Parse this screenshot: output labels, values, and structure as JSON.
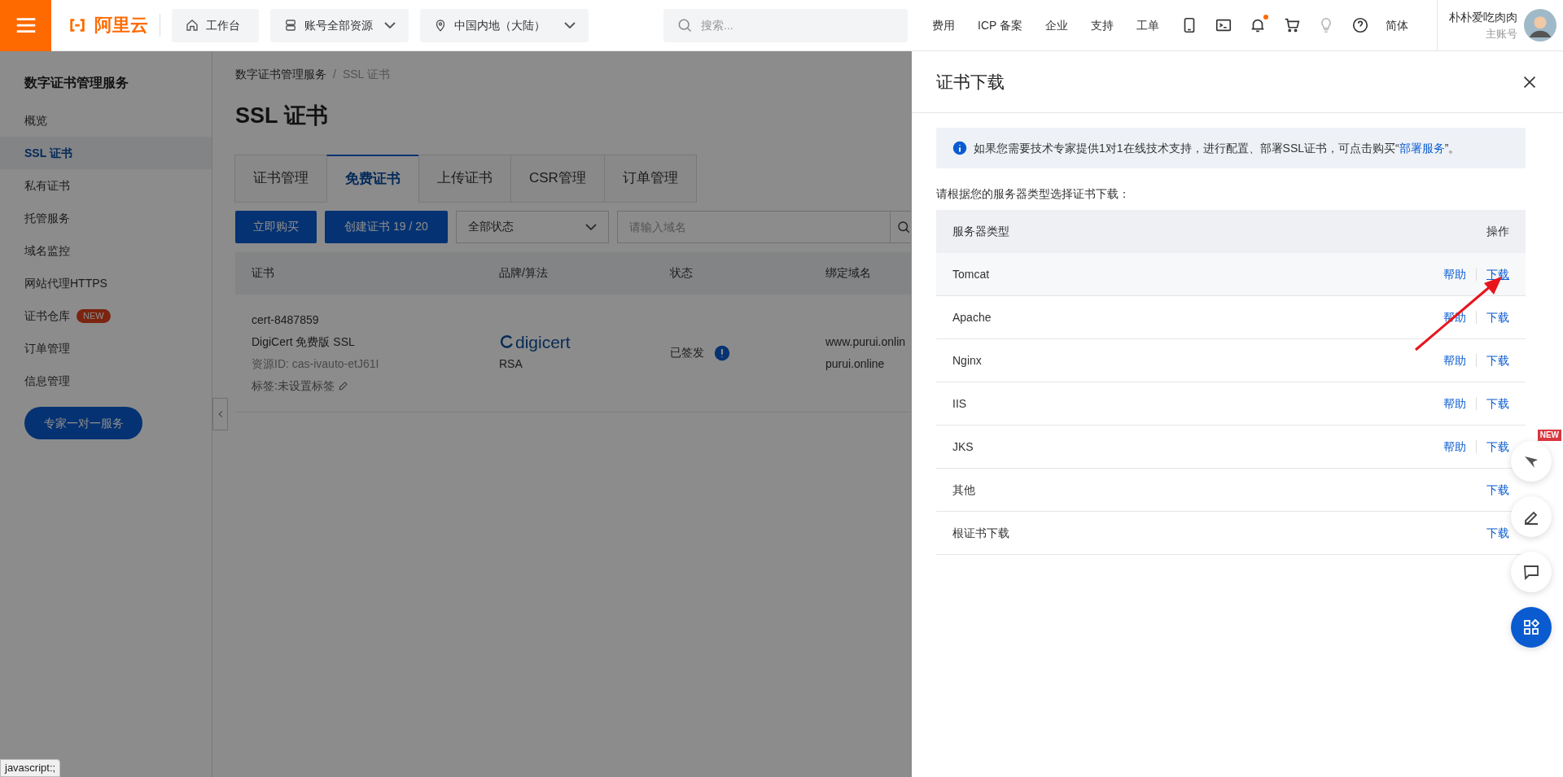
{
  "topbar": {
    "logo_text": "阿里云",
    "workbench": "工作台",
    "resource_select": "账号全部资源",
    "region_select": "中国内地（大陆）",
    "search_placeholder": "搜索...",
    "nav_links": [
      "费用",
      "ICP 备案",
      "企业",
      "支持",
      "工单"
    ],
    "notifications_unread": true,
    "language": "简体",
    "user_name": "朴朴爱吃肉肉",
    "user_role": "主账号"
  },
  "sidebar": {
    "title": "数字证书管理服务",
    "items": [
      {
        "label": "概览",
        "selected": false
      },
      {
        "label": "SSL 证书",
        "selected": true
      },
      {
        "label": "私有证书",
        "selected": false
      },
      {
        "label": "托管服务",
        "selected": false
      },
      {
        "label": "域名监控",
        "selected": false
      },
      {
        "label": "网站代理HTTPS",
        "selected": false
      },
      {
        "label": "证书仓库",
        "selected": false,
        "badge": "NEW"
      },
      {
        "label": "订单管理",
        "selected": false
      },
      {
        "label": "信息管理",
        "selected": false
      }
    ],
    "expert_button": "专家一对一服务"
  },
  "main": {
    "breadcrumb": [
      "数字证书管理服务",
      "/",
      "SSL 证书"
    ],
    "title": "SSL 证书",
    "tabs": [
      {
        "label": "证书管理",
        "selected": false
      },
      {
        "label": "免费证书",
        "selected": true
      },
      {
        "label": "上传证书",
        "selected": false
      },
      {
        "label": "CSR管理",
        "selected": false
      },
      {
        "label": "订单管理",
        "selected": false
      }
    ],
    "buy_button": "立即购买",
    "create_button": "创建证书 19 / 20",
    "status_select": "全部状态",
    "domain_search_placeholder": "请输入域名",
    "table": {
      "columns": [
        "证书",
        "品牌/算法",
        "状态",
        "绑定域名"
      ],
      "rows": [
        {
          "cert_name": "cert-8487859",
          "product": "DigiCert 免费版 SSL",
          "resource_id": "资源ID: cas-ivauto-etJ61I",
          "tags": "标签:未设置标签",
          "brand": "digicert",
          "algorithm": "RSA",
          "status": "已签发",
          "domains": [
            "www.purui.onlin",
            "purui.online"
          ]
        }
      ]
    }
  },
  "drawer": {
    "title": "证书下载",
    "notice": "如果您需要技术专家提供1对1在线技术支持，进行配置、部署SSL证书，可点击购买“",
    "notice_link": "部署服务",
    "notice_end": "”。",
    "prompt": "请根据您的服务器类型选择证书下载：",
    "columns": [
      "服务器类型",
      "操作"
    ],
    "rows": [
      {
        "name": "Tomcat",
        "help": "帮助",
        "download": "下载",
        "hovered": true
      },
      {
        "name": "Apache",
        "help": "帮助",
        "download": "下载",
        "hovered": false
      },
      {
        "name": "Nginx",
        "help": "帮助",
        "download": "下载",
        "hovered": false
      },
      {
        "name": "IIS",
        "help": "帮助",
        "download": "下载",
        "hovered": false
      },
      {
        "name": "JKS",
        "help": "帮助",
        "download": "下载",
        "hovered": false
      },
      {
        "name": "其他",
        "download": "下载",
        "hovered": false
      },
      {
        "name": "根证书下载",
        "download": "下载",
        "hovered": false
      }
    ]
  },
  "float_badge": "NEW",
  "status_tooltip": "javascript:;"
}
